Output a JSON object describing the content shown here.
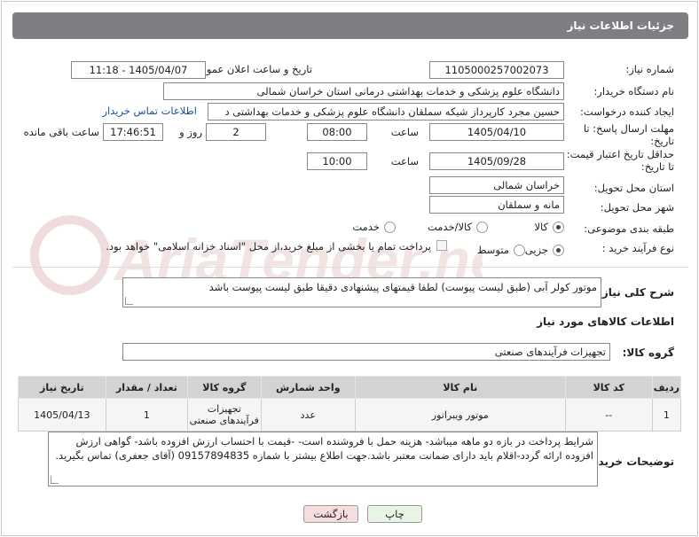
{
  "header": {
    "title": "جزئیات اطلاعات نیاز"
  },
  "fields": {
    "need_number_label": "شماره نیاز:",
    "need_number": "1105000257002073",
    "announce_label": "تاریخ و ساعت اعلان عمومی:",
    "announce_value": "1405/04/07 - 11:18",
    "buyer_org_label": "نام دستگاه خریدار:",
    "buyer_org": "دانشگاه علوم پزشکی و خدمات بهداشتی درمانی استان خراسان شمالی",
    "creator_label": "ایجاد کننده درخواست:",
    "creator": "حسین مجرد کارپرداز شبکه سملقان دانشگاه علوم پزشکی و خدمات بهداشتی د",
    "contact_link": "اطلاعات تماس خریدار",
    "deadline_label_1": "مهلت ارسال پاسخ: تا",
    "deadline_label_2": "تاریخ:",
    "deadline_date": "1405/04/10",
    "time_label": "ساعت",
    "deadline_time": "08:00",
    "days_value": "2",
    "days_label": "روز و",
    "remaining_time": "17:46:51",
    "remaining_label": "ساعت باقی مانده",
    "validity_label_1": "حداقل تاریخ اعتبار قیمت:",
    "validity_label_2": "تا تاریخ:",
    "validity_date": "1405/09/28",
    "validity_time_label": "ساعت",
    "validity_time": "10:00",
    "province_label": "استان محل تحویل:",
    "province": "خراسان شمالی",
    "city_label": "شهر محل تحویل:",
    "city": "مانه و سملقان",
    "category_label": "طبقه بندی موضوعی:",
    "category_options": [
      "کالا",
      "کالا/خدمت",
      "خدمت"
    ],
    "process_label": "نوع فرآیند خرید :",
    "process_options": [
      "جزیی",
      "متوسط"
    ],
    "payment_note": "پرداخت تمام یا بخشی از مبلغ خرید،از محل \"اسناد خزانه اسلامی\" خواهد بود."
  },
  "description": {
    "label": "شرح کلی نیاز:",
    "text": "موتور کولر آبی (طبق لیست پیوست) لطفا قیمتهای پیشنهادی دقیقا طبق لیست پیوست باشد"
  },
  "goods_section": {
    "title": "اطلاعات کالاهای مورد نیاز",
    "group_label": "گروه کالا:",
    "group_value": "تجهیزات فرآیندهای صنعتی"
  },
  "table": {
    "headers": [
      "ردیف",
      "کد کالا",
      "نام کالا",
      "واحد شمارش",
      "گروه کالا",
      "تعداد / مقدار",
      "تاریخ نیاز"
    ],
    "rows": [
      [
        "1",
        "--",
        "موتور ویبراتور",
        "عدد",
        "تجهیزات فرآیندهای صنعتی",
        "1",
        "1405/04/13"
      ]
    ]
  },
  "buyer_notes": {
    "label": "توضیحات خریدار:",
    "text": "شرایط پرداخت در بازه دو ماهه میباشد- هزینه حمل با فروشنده است- -قیمت با احتساب ارزش افزوده  باشد- گواهی ارزش افزوده ارائه گردد-اقلام باید دارای ضمانت معتبر باشد.جهت اطلاع بیشتر با شماره 09157894835 (آقای جعفری) تماس بگیرید."
  },
  "buttons": {
    "print": "چاپ",
    "back": "بازگشت"
  },
  "colors": {
    "header_bg": "#7d7f82",
    "print_btn": "#e9f5e4",
    "back_btn": "#f7dede",
    "link": "#1a4fa3"
  }
}
